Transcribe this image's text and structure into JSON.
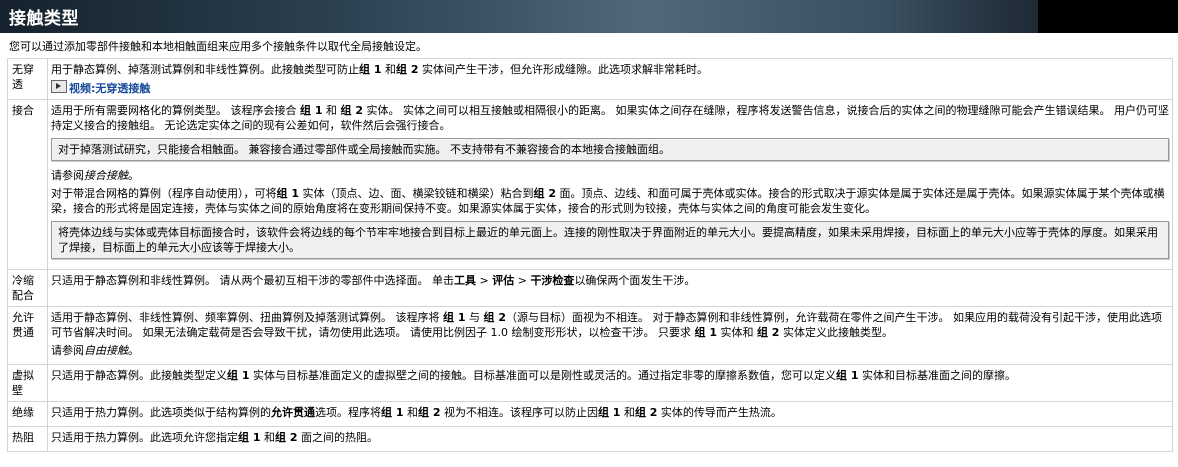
{
  "header": {
    "title": "接触类型"
  },
  "intro": "您可以通过添加零部件接触和本地相触面组来应用多个接触条件以取代全局接触设定。",
  "rows": {
    "no_penetration": {
      "term": "无穿透",
      "t1": "用于静态算例、掉落测试算例和非线性算例。此接触类型可防止",
      "b1": "组 1",
      "t2": " 和",
      "b2": "组 2",
      "t3": " 实体间产生干涉，但允许形成缝隙。此选项求解非常耗时。",
      "video_icon": "video-icon",
      "video_link": "视频:无穿透接触"
    },
    "bonded": {
      "term": "接合",
      "p1_a": "适用于所有需要网格化的算例类型。 该程序会接合 ",
      "p1_b1": "组 1",
      "p1_b": " 和 ",
      "p1_b2": "组 2",
      "p1_c": " 实体。 实体之间可以相互接触或相隔很小的距离。 如果实体之间存在缝隙，程序将发送警告信息，说接合后的实体之间的物理缝隙可能会产生错误结果。 用户仍可坚持定义接合的接触组。 无论选定实体之间的现有公差如何，软件然后会强行接合。",
      "note1": "对于掉落测试研究，只能接合相触面。 兼容接合通过零部件或全局接触而实施。 不支持带有不兼容接合的本地接合接触面组。",
      "see_also_prefix": "请参阅",
      "see_also_link": "接合接触",
      "see_also_suffix": "。",
      "p2_a": "对于带混合网格的算例（程序自动使用），可将",
      "p2_b1": "组 1",
      "p2_b": " 实体（顶点、边、面、横梁铰链和横梁）粘合到",
      "p2_b2": "组 2",
      "p2_c": " 面。顶点、边线、和面可属于壳体或实体。接合的形式取决于源实体是属于实体还是属于壳体。如果源实体属于某个壳体或横梁，接合的形式将是固定连接，壳体与实体之间的原始角度将在变形期间保持不变。如果源实体属于实体，接合的形式则为铰接，壳体与实体之间的角度可能会发生变化。",
      "note2": "将壳体边线与实体或壳体目标面接合时，该软件会将边线的每个节牢牢地接合到目标上最近的单元面上。连接的刚性取决于界面附近的单元大小。要提高精度，如果未采用焊接，目标面上的单元大小应等于壳体的厚度。如果采用了焊接，目标面上的单元大小应该等于焊接大小。"
    },
    "shrink_fit": {
      "term": "冷缩配合",
      "t1": "只适用于静态算例和非线性算例。 请从两个最初互相干涉的零部件中选择面。 单击",
      "b_tools": "工具",
      "gt1": " > ",
      "b_eval": "评估",
      "gt2": " > ",
      "b_interf": "干涉检查",
      "t2": "以确保两个面发生干涉。"
    },
    "allow_penetration": {
      "term": "允许贯通",
      "t1": "适用于静态算例、非线性算例、频率算例、扭曲算例及掉落测试算例。 该程序将 ",
      "b1": "组 1",
      "t2": " 与 ",
      "b2": "组 2",
      "t3": "（源与目标）面视为不相连。 对于静态算例和非线性算例，允许载荷在零件之间产生干涉。 如果应用的载荷没有引起干涉，使用此选项可节省解决时间。 如果无法确定载荷是否会导致干扰，请勿使用此选项。 请使用比例因子 1.0 绘制变形形状，以检查干涉。 只要求 ",
      "b3": "组 1",
      "t4": " 实体和 ",
      "b4": "组 2",
      "t5": " 实体定义此接触类型。",
      "see_also_prefix": "请参阅",
      "see_also_link": "自由接触",
      "see_also_suffix": "。"
    },
    "virtual_wall": {
      "term": "虚拟壁",
      "t1": "只适用于静态算例。此接触类型定义",
      "b1": "组 1",
      "t2": " 实体与目标基准面定义的虚拟壁之间的接触。目标基准面可以是刚性或灵活的。通过指定非零的摩擦系数值，您可以定义",
      "b2": "组 1",
      "t3": " 实体和目标基准面之间的摩擦。"
    },
    "insulated": {
      "term": "绝缘",
      "t1": "只适用于热力算例。此选项类似于结构算例的",
      "b_allow": "允许贯通",
      "t2": "选项。程序将",
      "b1": "组 1",
      "t3": " 和",
      "b2": "组 2",
      "t4": " 视为不相连。该程序可以防止因",
      "b3": "组 1",
      "t5": " 和",
      "b4": "组 2",
      "t6": " 实体的传导而产生热流。"
    },
    "thermal_resistance": {
      "term": "热阻",
      "t1": "只适用于热力算例。此选项允许您指定",
      "b1": "组 1",
      "t2": " 和",
      "b2": "组 2",
      "t3": " 面之间的热阻。"
    }
  }
}
